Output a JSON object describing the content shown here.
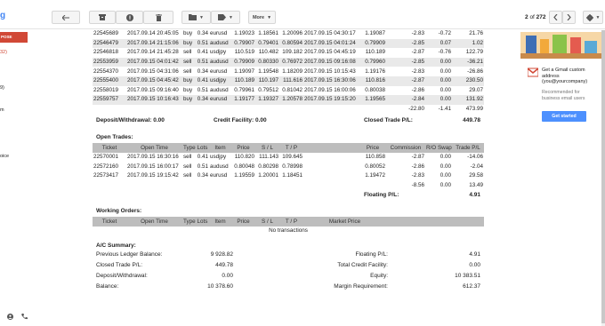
{
  "toolbar": {
    "more_label": "More",
    "pager_current": "2",
    "pager_of": "of",
    "pager_total": "272"
  },
  "sidebar": {
    "compose_fragment": "POSE",
    "fragments": [
      "32)",
      "9)",
      "m",
      "oice"
    ]
  },
  "closed_trades": {
    "rows": [
      [
        "22545689",
        "2017.09.14 20:45:05",
        "buy",
        "0.34",
        "eurusd",
        "1.19023",
        "1.18561",
        "1.20096",
        "2017.09.15 04:30:17",
        "1.19087",
        "-2.83",
        "-0.72",
        "21.76"
      ],
      [
        "22546479",
        "2017.09.14 21:15:06",
        "buy",
        "0.51",
        "audusd",
        "0.79907",
        "0.79401",
        "0.80594",
        "2017.09.15 04:01:24",
        "0.79909",
        "-2.85",
        "0.07",
        "1.02"
      ],
      [
        "22546818",
        "2017.09.14 21:45:28",
        "sell",
        "0.41",
        "usdjpy",
        "110.519",
        "110.482",
        "109.182",
        "2017.09.15 04:45:19",
        "110.189",
        "-2.87",
        "-0.76",
        "122.79"
      ],
      [
        "22553959",
        "2017.09.15 04:01:42",
        "sell",
        "0.51",
        "audusd",
        "0.79909",
        "0.80330",
        "0.76972",
        "2017.09.15 09:16:08",
        "0.79960",
        "-2.85",
        "0.00",
        "-36.21"
      ],
      [
        "22554370",
        "2017.09.15 04:31:06",
        "sell",
        "0.34",
        "eurusd",
        "1.19097",
        "1.19548",
        "1.18209",
        "2017.09.15 10:15:43",
        "1.19176",
        "-2.83",
        "0.00",
        "-26.86"
      ],
      [
        "22555400",
        "2017.09.15 04:45:42",
        "buy",
        "0.41",
        "usdjpy",
        "110.189",
        "110.197",
        "111.616",
        "2017.09.15 16:30:06",
        "110.816",
        "-2.87",
        "0.00",
        "230.50"
      ],
      [
        "22558019",
        "2017.09.15 09:16:40",
        "buy",
        "0.51",
        "audusd",
        "0.79961",
        "0.79512",
        "0.81042",
        "2017.09.15 16:00:06",
        "0.80038",
        "-2.86",
        "0.00",
        "29.07"
      ],
      [
        "22559757",
        "2017.09.15 10:16:43",
        "buy",
        "0.34",
        "eurusd",
        "1.19177",
        "1.19327",
        "1.20578",
        "2017.09.15 19:15:20",
        "1.19565",
        "-2.84",
        "0.00",
        "131.92"
      ]
    ],
    "totals": {
      "commission": "-22.80",
      "swap": "-1.41",
      "profit": "473.99"
    },
    "deposit_label": "Deposit/Withdrawal: 0.00",
    "credit_label": "Credit Facility: 0.00",
    "closed_pl_label": "Closed Trade P/L:",
    "closed_pl_value": "449.78"
  },
  "open_trades": {
    "title": "Open Trades:",
    "headers": [
      "Ticket",
      "Open Time",
      "Type",
      "Lots",
      "Item",
      "Price",
      "S / L",
      "T / P",
      "",
      "Price",
      "Commission",
      "R/O Swap",
      "Trade P/L"
    ],
    "rows": [
      [
        "22570001",
        "2017.09.15 16:30:16",
        "sell",
        "0.41",
        "usdjpy",
        "110.820",
        "111.143",
        "109.645",
        "",
        "110.858",
        "-2.87",
        "0.00",
        "-14.06"
      ],
      [
        "22572160",
        "2017.09.15 16:00:17",
        "sell",
        "0.51",
        "audusd",
        "0.80048",
        "0.80298",
        "0.78998",
        "",
        "0.80052",
        "-2.86",
        "0.00",
        "-2.04"
      ],
      [
        "22573417",
        "2017.09.15 19:15:42",
        "sell",
        "0.34",
        "eurusd",
        "1.19559",
        "1.20001",
        "1.18451",
        "",
        "1.19472",
        "-2.83",
        "0.00",
        "29.58"
      ]
    ],
    "totals": {
      "commission": "-8.56",
      "swap": "0.00",
      "profit": "13.49"
    },
    "floating_label": "Floating P/L:",
    "floating_value": "4.91"
  },
  "working_orders": {
    "title": "Working Orders:",
    "headers": [
      "Ticket",
      "Open Time",
      "Type",
      "Lots",
      "Item",
      "Price",
      "S / L",
      "T / P",
      "Market Price",
      "",
      ""
    ],
    "empty": "No transactions"
  },
  "summary": {
    "title": "A/C Summary:",
    "left": [
      {
        "label": "Previous Ledger Balance:",
        "value": "9 928.82"
      },
      {
        "label": "Closed Trade P/L:",
        "value": "449.78"
      },
      {
        "label": "Deposit/Withdrawal:",
        "value": "0.00"
      },
      {
        "label": "Balance:",
        "value": "10 378.60"
      }
    ],
    "right": [
      {
        "label": "Floating P/L:",
        "value": "4.91"
      },
      {
        "label": "Total Credit Facility:",
        "value": "0.00"
      },
      {
        "label": "Equity:",
        "value": "10 383.51"
      },
      {
        "label": "Margin Requirement:",
        "value": "612.37"
      }
    ]
  },
  "ad": {
    "title": "Get a Gmail custom address (you@yourcompany)",
    "subtitle": "Recommended for business email users",
    "button": "Get started"
  }
}
